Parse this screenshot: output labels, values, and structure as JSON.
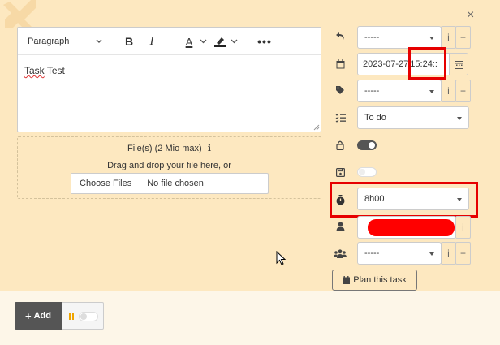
{
  "dialog": {
    "close_glyph": "×"
  },
  "editor": {
    "block_format": "Paragraph",
    "toolbar": {
      "bold": "B",
      "italic": "I",
      "font_color": "A",
      "more": "•••"
    },
    "content": {
      "word1": "Task",
      "word2": "Test"
    }
  },
  "files": {
    "title": "File(s) (2 Mio max)",
    "info_glyph": "ℹ",
    "drop_hint": "Drag and drop your file here, or",
    "choose_label": "Choose Files",
    "no_file_label": "No file chosen"
  },
  "side": {
    "rows": [
      {
        "icon": "undo-icon",
        "value": "-----"
      },
      {
        "icon": "calendar-icon",
        "date": "2023-07-27",
        "time": "15:24::"
      },
      {
        "icon": "tag-icon",
        "value": "-----"
      },
      {
        "icon": "list-check-icon",
        "value": "To do"
      },
      {
        "icon": "lock-icon",
        "toggle": "on"
      },
      {
        "icon": "save-icon",
        "toggle": "off"
      },
      {
        "icon": "stopwatch-icon",
        "value": "8h00"
      },
      {
        "icon": "user-icon",
        "value": ""
      },
      {
        "icon": "users-icon",
        "value": "-----"
      }
    ],
    "info_glyph": "i",
    "plus_glyph": "+",
    "plan_label": "Plan this task"
  },
  "footer": {
    "add_label": "Add",
    "add_glyph": "+"
  },
  "colors": {
    "background": "#fde8c0",
    "footer_bg": "#fdf6e8",
    "highlight": "#e60000",
    "toggle_on": "#555555",
    "pause_accent": "#f0a500"
  }
}
